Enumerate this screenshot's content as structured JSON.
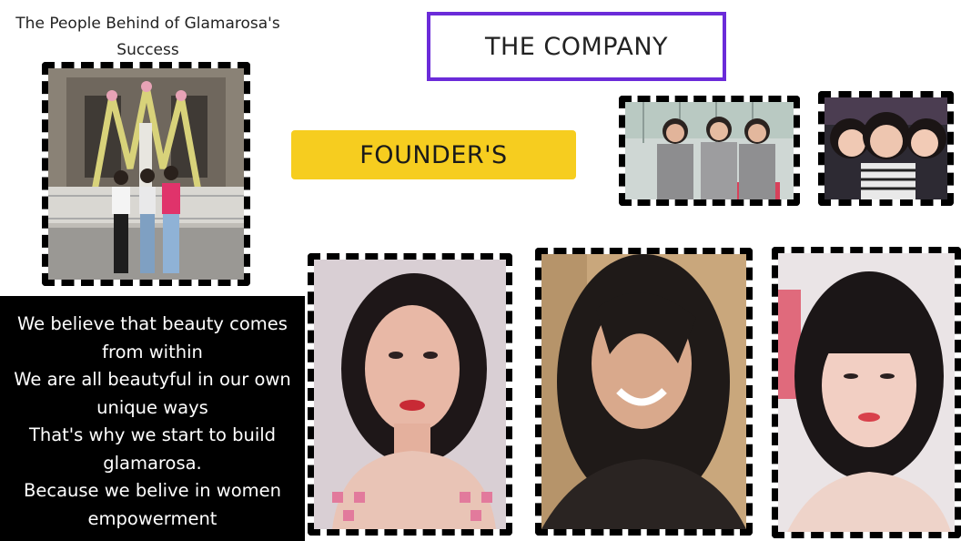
{
  "header": {
    "left_title": "The People Behind of Glamarosa's Success",
    "company": "THE COMPANY",
    "founders": "FOUNDER'S"
  },
  "mission": {
    "lines": [
      "We believe that beauty comes from within",
      "We are all beautyful in our own unique ways",
      "That's why we start to build glamarosa.",
      "Because we belive in women empowerment"
    ]
  },
  "colors": {
    "company_border": "#6b2bd9",
    "founders_band": "#f6cd1f",
    "mission_bg": "#000000",
    "photo_frame": "#000000"
  }
}
